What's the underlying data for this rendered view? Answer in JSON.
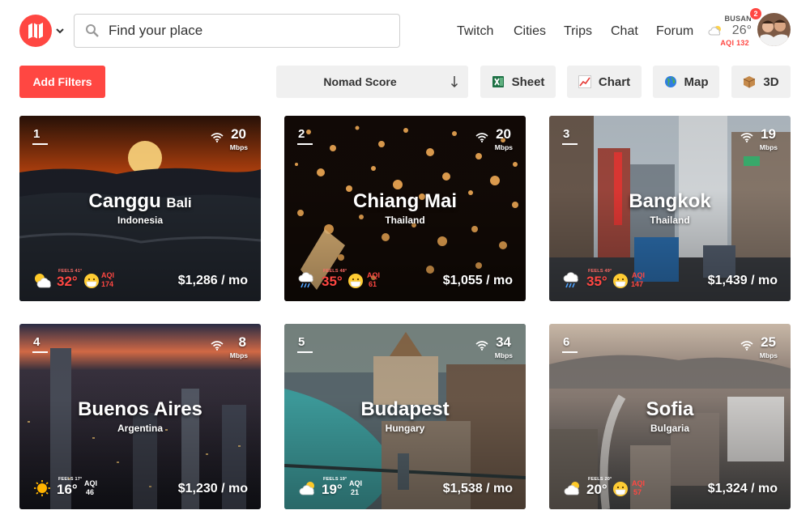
{
  "header": {
    "search_placeholder": "Find your place",
    "nav": [
      "Twitch",
      "Cities",
      "Trips",
      "Chat",
      "Forum"
    ],
    "weather": {
      "city": "BUSAN",
      "temp": "26°",
      "aqi": "AQI 132",
      "icon": "cloud-icon"
    },
    "notification_count": "2",
    "brand_color": "#ff4742"
  },
  "toolbar": {
    "filters_label": "Add Filters",
    "sort_label": "Nomad Score",
    "sheet_label": "Sheet",
    "chart_label": "Chart",
    "map_label": "Map",
    "threed_label": "3D"
  },
  "cities": [
    {
      "rank": "1",
      "name": "Canggu",
      "region": "Bali",
      "country": "Indonesia",
      "mbps": "20",
      "mbps_unit": "Mbps",
      "feels": "FEELS 41°",
      "temp": "32°",
      "aqi_label": "AQI",
      "aqi": "174",
      "cost": "$1,286 / mo",
      "weather_icon": "sun-cloud-icon",
      "aqi_face": "masked-face-icon"
    },
    {
      "rank": "2",
      "name": "Chiang Mai",
      "region": "",
      "country": "Thailand",
      "mbps": "20",
      "mbps_unit": "Mbps",
      "feels": "FEELS 48°",
      "temp": "35°",
      "aqi_label": "AQI",
      "aqi": "61",
      "cost": "$1,055 / mo",
      "weather_icon": "rain-cloud-icon",
      "aqi_face": "masked-face-icon"
    },
    {
      "rank": "3",
      "name": "Bangkok",
      "region": "",
      "country": "Thailand",
      "mbps": "19",
      "mbps_unit": "Mbps",
      "feels": "FEELS 49°",
      "temp": "35°",
      "aqi_label": "AQI",
      "aqi": "147",
      "cost": "$1,439 / mo",
      "weather_icon": "rain-cloud-icon",
      "aqi_face": "masked-face-icon"
    },
    {
      "rank": "4",
      "name": "Buenos Aires",
      "region": "",
      "country": "Argentina",
      "mbps": "8",
      "mbps_unit": "Mbps",
      "feels": "FEELS 17°",
      "temp": "16°",
      "aqi_label": "AQI",
      "aqi": "46",
      "cost": "$1,230 / mo",
      "weather_icon": "sun-icon",
      "aqi_face": ""
    },
    {
      "rank": "5",
      "name": "Budapest",
      "region": "",
      "country": "Hungary",
      "mbps": "34",
      "mbps_unit": "Mbps",
      "feels": "FEELS 19°",
      "temp": "19°",
      "aqi_label": "AQI",
      "aqi": "21",
      "cost": "$1,538 / mo",
      "weather_icon": "cloud-icon",
      "aqi_face": ""
    },
    {
      "rank": "6",
      "name": "Sofia",
      "region": "",
      "country": "Bulgaria",
      "mbps": "25",
      "mbps_unit": "Mbps",
      "feels": "FEELS 20°",
      "temp": "20°",
      "aqi_label": "AQI",
      "aqi": "57",
      "cost": "$1,324 / mo",
      "weather_icon": "cloud-icon",
      "aqi_face": "masked-face-icon"
    }
  ]
}
